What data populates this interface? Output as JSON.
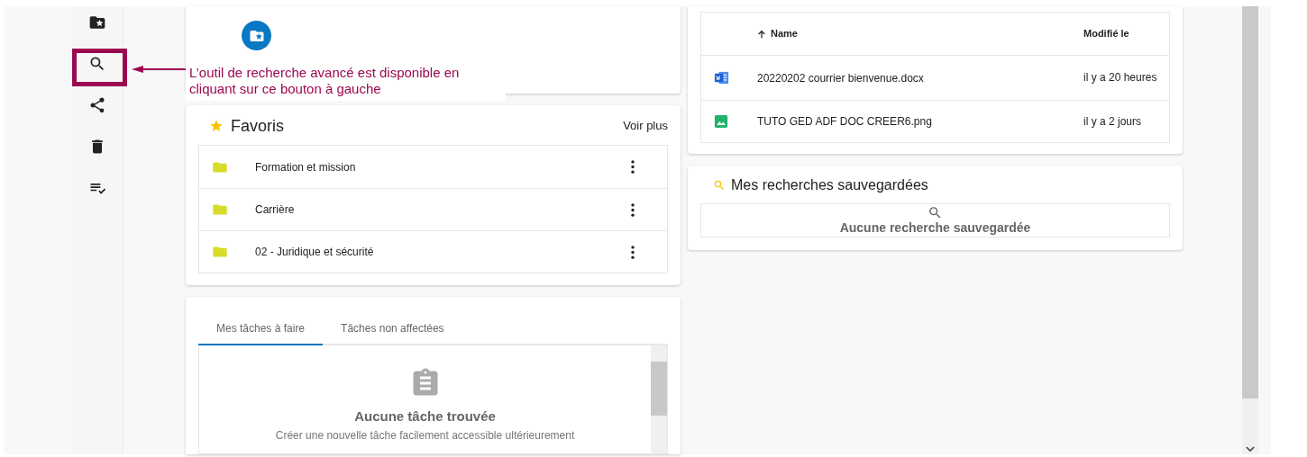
{
  "sidebar": {
    "items": [
      {
        "kind": "folder-star"
      },
      {
        "kind": "search"
      },
      {
        "kind": "share"
      },
      {
        "kind": "trash"
      },
      {
        "kind": "tasks"
      }
    ]
  },
  "annotation": {
    "text": "L’outil de recherche avancé est disponible en\ncliquant sur ce bouton à gauche"
  },
  "favorites": {
    "title": "Favoris",
    "more": "Voir plus",
    "items": [
      {
        "name": "Formation et mission"
      },
      {
        "name": "Carrière"
      },
      {
        "name": "02 - Juridique et sécurité"
      }
    ]
  },
  "tasks": {
    "tabs": [
      {
        "label": "Mes tâches à faire",
        "selected": true
      },
      {
        "label": "Tâches non affectées",
        "selected": false
      }
    ],
    "empty_title": "Aucune tâche trouvée",
    "empty_text": "Créer une nouvelle tâche facilement accessible ultérieurement"
  },
  "files": {
    "columns": [
      {
        "label": "Name",
        "sorted": true
      },
      {
        "label": "Modifié le",
        "sorted": false
      }
    ],
    "rows": [
      {
        "kind": "word",
        "name": "20220202 courrier bienvenue.docx",
        "modified": "il y a 20 heures"
      },
      {
        "kind": "image",
        "name": "TUTO GED ADF DOC CREER6.png",
        "modified": "il y a 2 jours"
      }
    ]
  },
  "saved_searches": {
    "title": "Mes recherches sauvegardées",
    "empty_text": "Aucune recherche sauvegardée"
  }
}
